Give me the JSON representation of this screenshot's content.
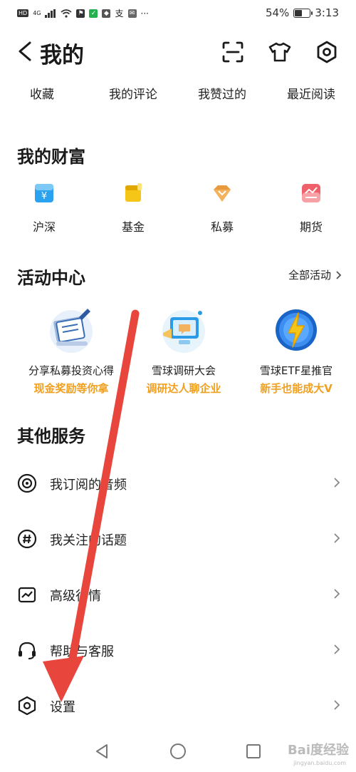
{
  "status_bar": {
    "hd": "HD",
    "net": "4G",
    "battery": "54%",
    "battery_level": 0.54,
    "time": "3:13",
    "more": "···",
    "app_icons": [
      "alipay-icon",
      "message-icon"
    ]
  },
  "header": {
    "title": "我的"
  },
  "tabs": [
    "收藏",
    "我的评论",
    "我赞过的",
    "最近阅读"
  ],
  "wealth": {
    "title": "我的财富",
    "items": [
      {
        "label": "沪深",
        "icon": "hushen-icon"
      },
      {
        "label": "基金",
        "icon": "fund-icon"
      },
      {
        "label": "私募",
        "icon": "private-fund-icon"
      },
      {
        "label": "期货",
        "icon": "futures-icon"
      }
    ]
  },
  "activity": {
    "title": "活动中心",
    "all_label": "全部活动",
    "items": [
      {
        "line1": "分享私募投资心得",
        "line2": "现金奖励等你拿"
      },
      {
        "line1": "雪球调研大会",
        "line2": "调研达人聊企业"
      },
      {
        "line1": "雪球ETF星推官",
        "line2": "新手也能成大V"
      }
    ]
  },
  "services": {
    "title": "其他服务",
    "items": [
      {
        "label": "我订阅的音频",
        "icon": "audio-icon"
      },
      {
        "label": "我关注的话题",
        "icon": "hashtag-icon"
      },
      {
        "label": "高级行情",
        "icon": "chart-icon"
      },
      {
        "label": "帮助与客服",
        "icon": "headset-icon"
      },
      {
        "label": "设置",
        "icon": "settings-icon"
      }
    ]
  },
  "watermark": {
    "main": "Bai度经验",
    "sub": "jingyan.baidu.com"
  },
  "colors": {
    "accent_orange": "#f0a020",
    "arrow_red": "#e8453c"
  }
}
